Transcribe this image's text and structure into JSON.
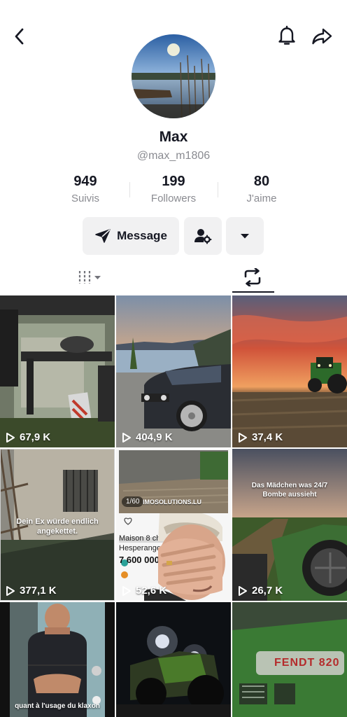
{
  "profile": {
    "name": "Max",
    "handle": "@max_m1806"
  },
  "stats": [
    {
      "value": "949",
      "label": "Suivis"
    },
    {
      "value": "199",
      "label": "Followers"
    },
    {
      "value": "80",
      "label": "J'aime"
    }
  ],
  "actions": {
    "message_label": "Message"
  },
  "videos": [
    {
      "views": "67,9 K",
      "overlay": ""
    },
    {
      "views": "404,9 K",
      "overlay": ""
    },
    {
      "views": "37,4 K",
      "overlay": ""
    },
    {
      "views": "377,1 K",
      "overlay": "Dein Ex würde endlich angekettet."
    },
    {
      "views": "52,6 K",
      "overlay": "",
      "counter": "1/60",
      "site": "IMOSOLUTIONS.LU",
      "listing_title": "Maison 8 ch",
      "listing_place": "Hesperange",
      "listing_price": "7 600 000"
    },
    {
      "views": "26,7 K",
      "overlay": "Das Mädchen was 24/7 Bombe aussieht"
    },
    {
      "views": "",
      "overlay": "quant à l'usage du klaxon"
    },
    {
      "views": "",
      "overlay": ""
    },
    {
      "views": "",
      "overlay": "FENDT 820"
    }
  ],
  "colors": {
    "text": "#161823",
    "secondary": "#8a8b91",
    "button_bg": "#f1f1f2"
  }
}
